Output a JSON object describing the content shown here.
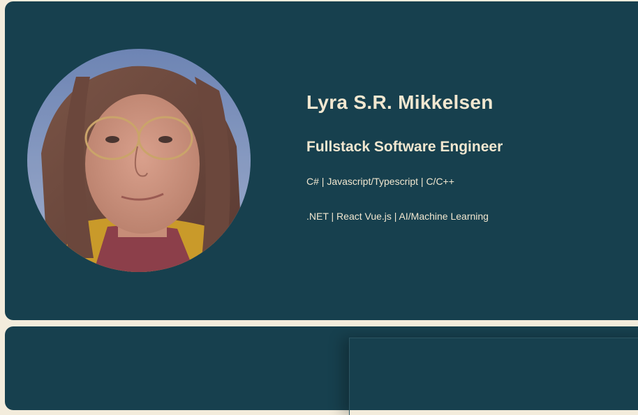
{
  "profile": {
    "name": "Lyra S.R. Mikkelsen",
    "role": "Fullstack Software Engineer",
    "skills_line": "C# | Javascript/Typescript | C/C++",
    "frameworks_line": ".NET | React Vue.js | AI/Machine Learning"
  },
  "colors": {
    "card_background": "#17404e",
    "page_background": "#f3ecdc",
    "text": "#f1e7d0"
  },
  "avatar": {
    "icon": "profile-photo"
  }
}
